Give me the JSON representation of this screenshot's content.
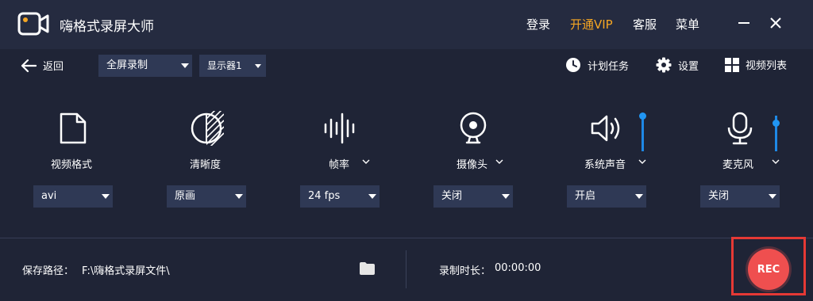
{
  "app": {
    "title": "嗨格式录屏大师"
  },
  "topnav": {
    "login": "登录",
    "vip": "开通VIP",
    "service": "客服",
    "menu": "菜单"
  },
  "toolbar": {
    "back": "返回",
    "mode": "全屏录制",
    "display": "显示器1",
    "schedule": "计划任务",
    "settings": "设置",
    "videolist": "视频列表"
  },
  "options": [
    {
      "label": "视频格式",
      "value": "avi"
    },
    {
      "label": "清晰度",
      "value": "原画"
    },
    {
      "label": "帧率",
      "value": "24 fps"
    },
    {
      "label": "摄像头",
      "value": "关闭"
    },
    {
      "label": "系统声音",
      "value": "开启",
      "volume": 1.0
    },
    {
      "label": "麦克风",
      "value": "关闭",
      "volume": 0.8
    }
  ],
  "footer": {
    "path_label": "保存路径：",
    "path_value": "F:\\嗨格式录屏文件\\",
    "duration_label": "录制时长：",
    "duration_value": "00:00:00",
    "rec_label": "REC"
  },
  "colors": {
    "background": "#1f2436",
    "titlebar": "#252b40",
    "vip": "#f5a623",
    "accent": "#2196f3",
    "rec": "#ef4f4f",
    "highlight": "#e53935"
  }
}
